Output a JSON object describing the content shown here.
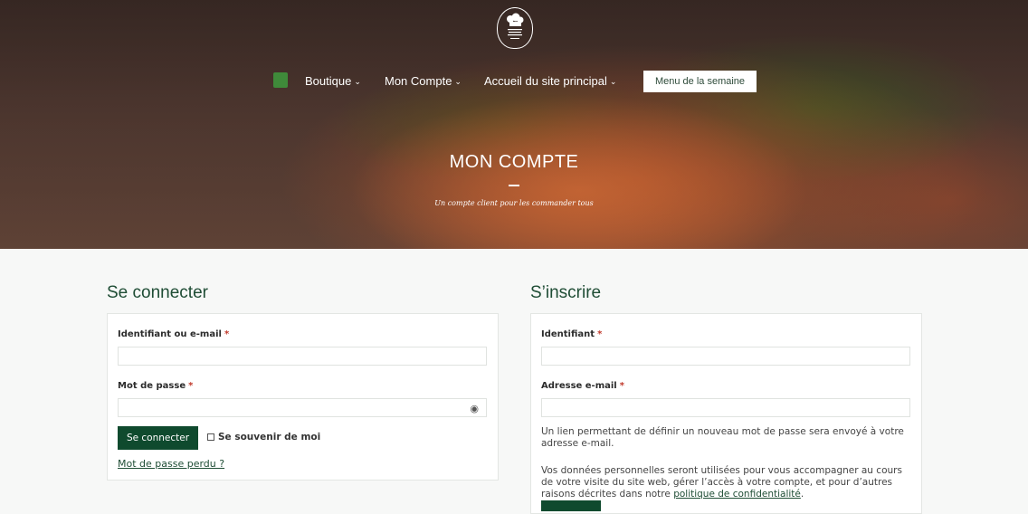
{
  "nav": {
    "items": [
      {
        "label": "Boutique",
        "chevron": "⌄"
      },
      {
        "label": "Mon Compte",
        "chevron": "⌄"
      },
      {
        "label": "Accueil du site principal",
        "chevron": "⌄"
      }
    ],
    "menu_button": "Menu de la semaine"
  },
  "hero": {
    "title": "MON COMPTE",
    "subtitle": "Un compte client pour les commander tous"
  },
  "login": {
    "title": "Se connecter",
    "username_label": "Identifiant ou e-mail",
    "password_label": "Mot de passe",
    "required_mark": "*",
    "submit": "Se connecter",
    "remember": "Se souvenir de moi",
    "lost_password": "Mot de passe perdu ?"
  },
  "register": {
    "title": "S’inscrire",
    "username_label": "Identifiant",
    "email_label": "Adresse e-mail",
    "required_mark": "*",
    "password_note": "Un lien permettant de définir un nouveau mot de passe sera envoyé à votre adresse e-mail.",
    "privacy_text": "Vos données personnelles seront utilisées pour vous accompagner au cours de votre visite du site web, gérer l’accès à votre compte, et pour d’autres raisons décrites dans notre ",
    "privacy_link": "politique de confidentialité",
    "privacy_end": "."
  }
}
